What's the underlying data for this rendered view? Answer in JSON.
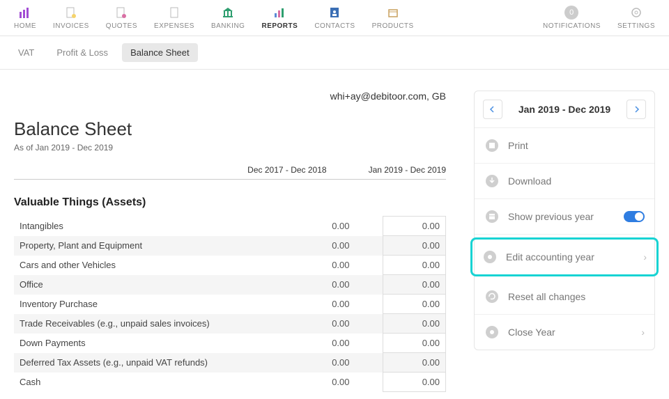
{
  "nav": {
    "home": "HOME",
    "invoices": "INVOICES",
    "quotes": "QUOTES",
    "expenses": "EXPENSES",
    "banking": "BANKING",
    "reports": "REPORTS",
    "contacts": "CONTACTS",
    "products": "PRODUCTS",
    "notifications": "NOTIFICATIONS",
    "notifications_count": "0",
    "settings": "SETTINGS"
  },
  "subnav": {
    "vat": "VAT",
    "pl": "Profit & Loss",
    "balance": "Balance Sheet"
  },
  "report": {
    "company": "whi+ay@debitoor.com, GB",
    "title": "Balance Sheet",
    "subtitle": "As of Jan 2019 - Dec 2019",
    "period1": "Dec 2017 - Dec 2018",
    "period2": "Jan 2019 - Dec 2019",
    "section": "Valuable Things (Assets)",
    "rows": [
      {
        "label": "Intangibles",
        "v1": "0.00",
        "v2": "0.00"
      },
      {
        "label": "Property, Plant and Equipment",
        "v1": "0.00",
        "v2": "0.00"
      },
      {
        "label": "Cars and other Vehicles",
        "v1": "0.00",
        "v2": "0.00"
      },
      {
        "label": "Office",
        "v1": "0.00",
        "v2": "0.00"
      },
      {
        "label": "Inventory Purchase",
        "v1": "0.00",
        "v2": "0.00"
      },
      {
        "label": "Trade Receivables (e.g., unpaid sales invoices)",
        "v1": "0.00",
        "v2": "0.00"
      },
      {
        "label": "Down Payments",
        "v1": "0.00",
        "v2": "0.00"
      },
      {
        "label": "Deferred Tax Assets (e.g., unpaid VAT refunds)",
        "v1": "0.00",
        "v2": "0.00"
      },
      {
        "label": "Cash",
        "v1": "0.00",
        "v2": "0.00"
      }
    ]
  },
  "side": {
    "period": "Jan 2019 - Dec 2019",
    "print": "Print",
    "download": "Download",
    "show_prev": "Show previous year",
    "edit_year": "Edit accounting year",
    "reset": "Reset all changes",
    "close_year": "Close Year"
  }
}
